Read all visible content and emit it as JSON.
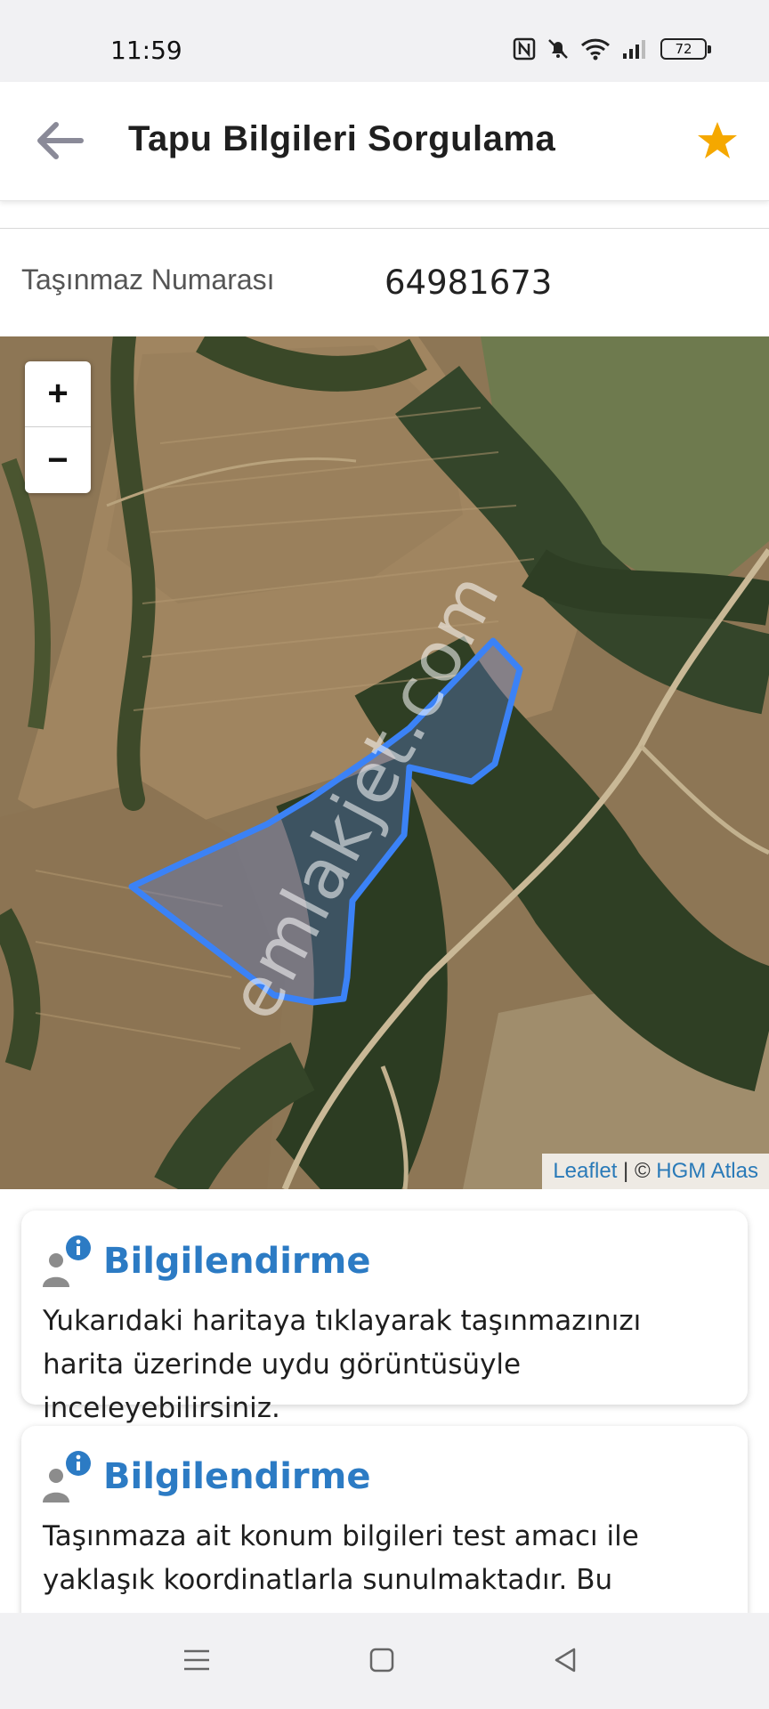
{
  "status_bar": {
    "time": "11:59",
    "battery_level": "72",
    "icons": [
      "nfc-icon",
      "mute-icon",
      "wifi-icon",
      "signal-icon",
      "battery-icon"
    ]
  },
  "app_bar": {
    "title": "Tapu Bilgileri Sorgulama",
    "back_icon": "arrow-left-icon",
    "favorite_icon": "star-icon",
    "favorite_color": "#f5a800"
  },
  "parcel": {
    "label": "Taşınmaz Numarası",
    "value": "64981673"
  },
  "map": {
    "zoom_in": "+",
    "zoom_out": "−",
    "attribution_leaflet": "Leaflet",
    "attribution_separator": " | © ",
    "attribution_source": "HGM Atlas",
    "watermark": "emlakjet.com",
    "parcel_outline_color": "#3b82f6"
  },
  "cards": [
    {
      "title": "Bilgilendirme",
      "text": "Yukarıdaki haritaya tıklayarak taşınmazınızı harita üzerinde uydu görüntüsüyle inceleyebilirsiniz."
    },
    {
      "title": "Bilgilendirme",
      "text": "Taşınmaza ait konum bilgileri test amacı ile yaklaşık koordinatlarla sunulmaktadır. Bu"
    }
  ],
  "colors": {
    "accent": "#2c7bc4",
    "info_badge": "#2c7bc4"
  },
  "nav_bar": {
    "icons": [
      "menu-icon",
      "home-icon",
      "back-triangle-icon"
    ]
  }
}
